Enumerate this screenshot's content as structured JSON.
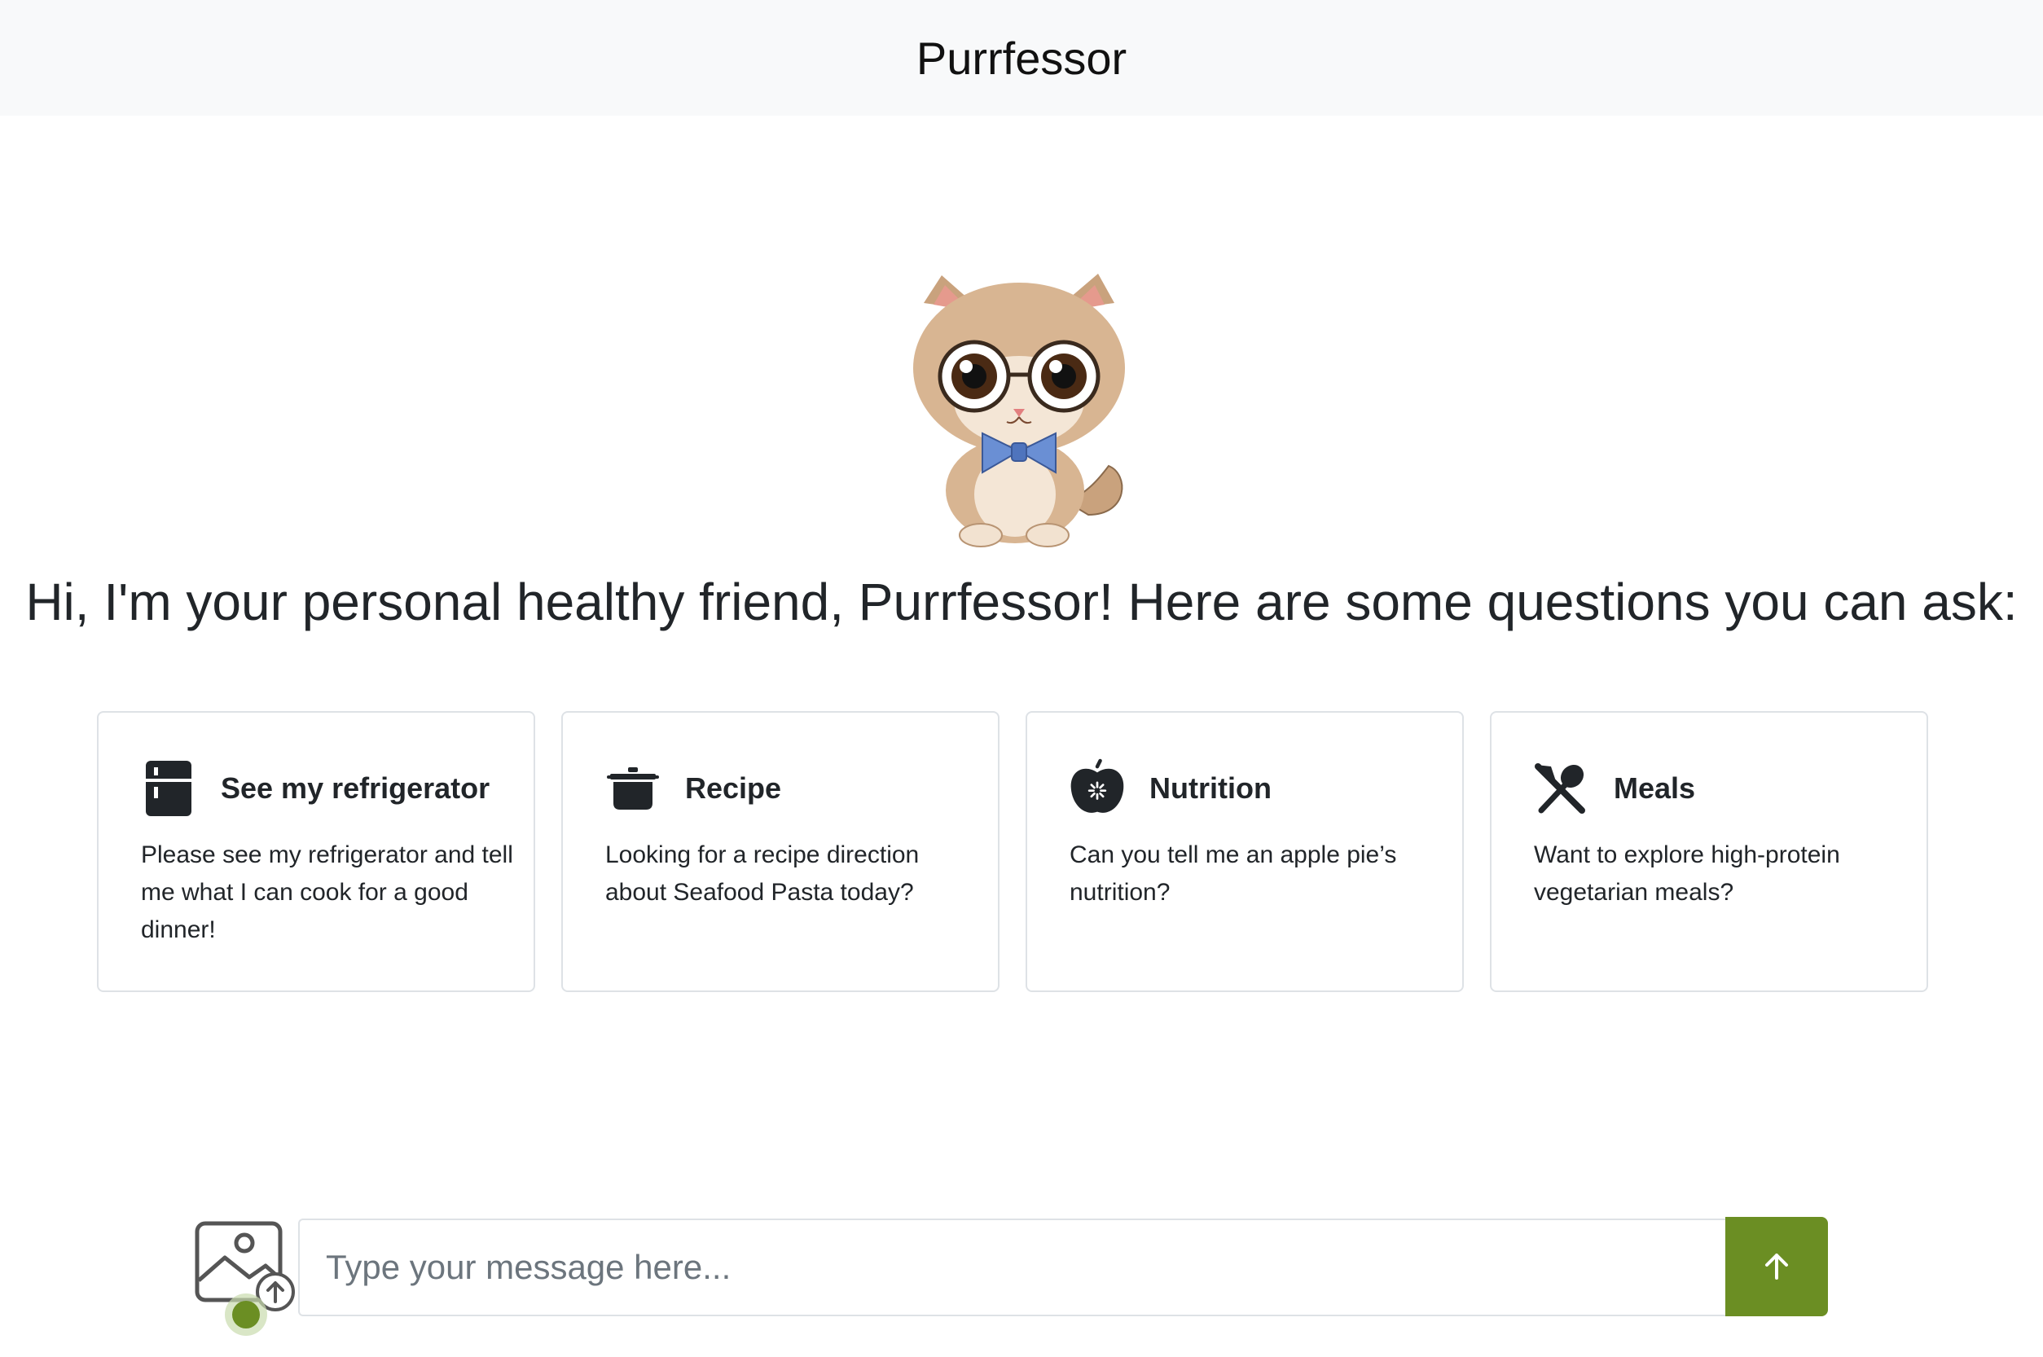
{
  "header": {
    "title": "Purrfessor"
  },
  "mascot": {
    "name": "cat-professor-mascot"
  },
  "greeting": "Hi, I'm your personal healthy friend, Purrfessor! Here are some questions you can ask:",
  "cards": [
    {
      "icon": "refrigerator-icon",
      "title": "See my refrigerator",
      "text": "Please see my refrigerator and tell me what I can cook for a good dinner!"
    },
    {
      "icon": "cooking-pot-icon",
      "title": "Recipe",
      "text": "Looking for a recipe direction about Seafood Pasta today?"
    },
    {
      "icon": "apple-icon",
      "title": "Nutrition",
      "text": "Can you tell me an apple pie’s nutrition?"
    },
    {
      "icon": "utensils-icon",
      "title": "Meals",
      "text": "Want to explore high-protein vegetarian meals?"
    }
  ],
  "composer": {
    "placeholder": "Type your message here...",
    "value": "",
    "upload_icon": "image-upload-icon",
    "send_icon": "arrow-up-icon"
  },
  "colors": {
    "header_bg": "#f8f9fa",
    "accent": "#6b8e23",
    "card_border": "#dee2e6"
  }
}
